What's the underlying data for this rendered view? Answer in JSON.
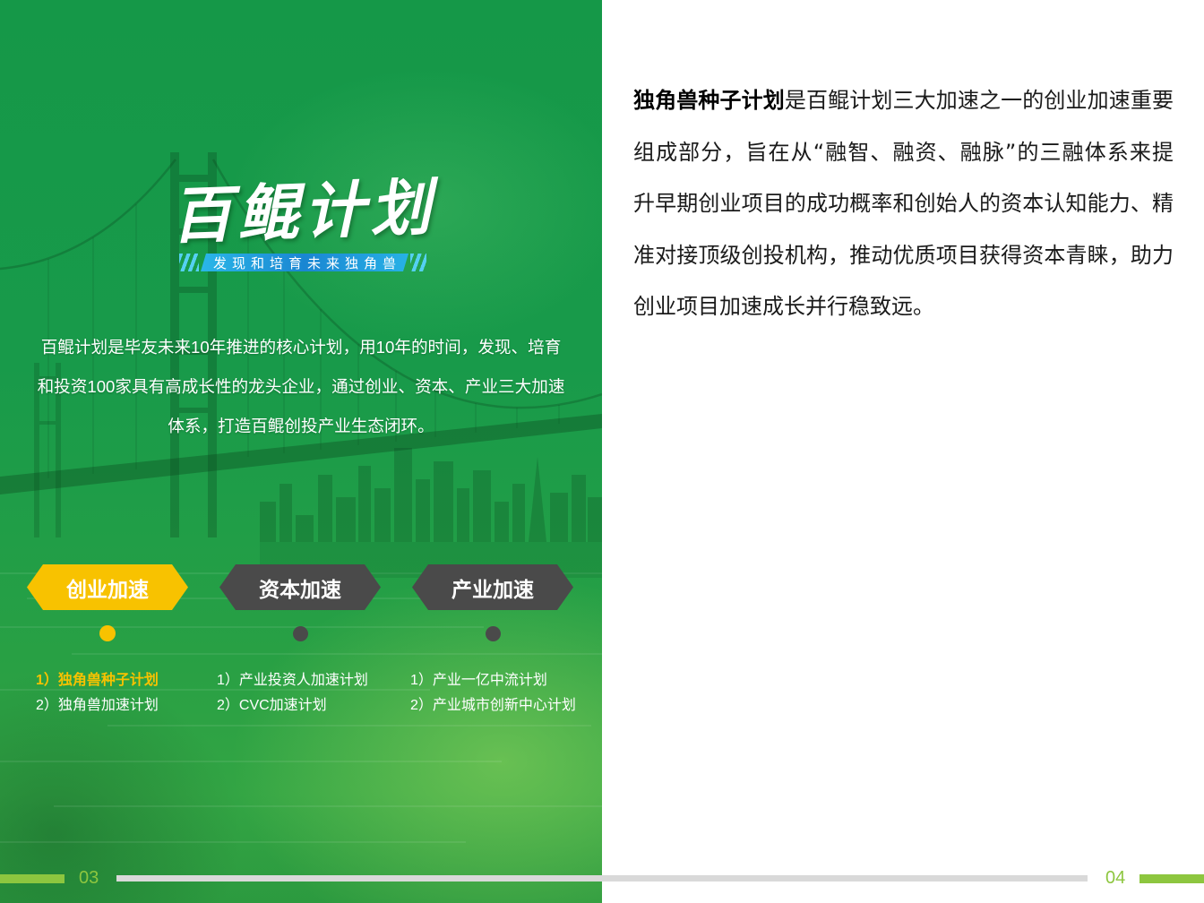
{
  "left_page": {
    "title": "百鲲计划",
    "subtitle": "发现和培育未来独角兽",
    "description_lines": [
      "百鲲计划是毕友未来10年推进的核心计划，用10年的时间，发现、培育",
      "和投资100家具有高成长性的龙头企业，通过创业、资本、产业三大加速",
      "体系，打造百鲲创投产业生态闭环。"
    ],
    "tracks": [
      {
        "label": "创业加速",
        "active": true,
        "items": [
          {
            "text": "1）独角兽种子计划",
            "highlighted": true
          },
          {
            "text": "2）独角兽加速计划",
            "highlighted": false
          }
        ]
      },
      {
        "label": "资本加速",
        "active": false,
        "items": [
          {
            "text": "1）产业投资人加速计划",
            "highlighted": false
          },
          {
            "text": "2）CVC加速计划",
            "highlighted": false
          }
        ]
      },
      {
        "label": "产业加速",
        "active": false,
        "items": [
          {
            "text": "1）产业一亿中流计划",
            "highlighted": false
          },
          {
            "text": "2）产业城市创新中心计划",
            "highlighted": false
          }
        ]
      }
    ],
    "page_number": "03"
  },
  "right_page": {
    "lead": "独角兽种子计划",
    "lines": [
      "是百鲲计划三大加速之一的创业加速重要",
      "组成部分，旨在从“融智、融资、融脉”的三融体系来提",
      "升早期创业项目的成功概率和创始人的资本认知能力、精",
      "准对接顶级创投机构，推动优质项目获得资本青睐，助力",
      "创业项目加速成长并行稳致远。"
    ],
    "page_number": "04"
  },
  "colors": {
    "primary_green": "#179A4A",
    "accent_yellow": "#F8C200",
    "tag_gray": "#4A4A4A",
    "page_number_green": "#8DC63F",
    "progress_track_gray": "#D9D9D9",
    "body_text": "#1A1A1A"
  }
}
